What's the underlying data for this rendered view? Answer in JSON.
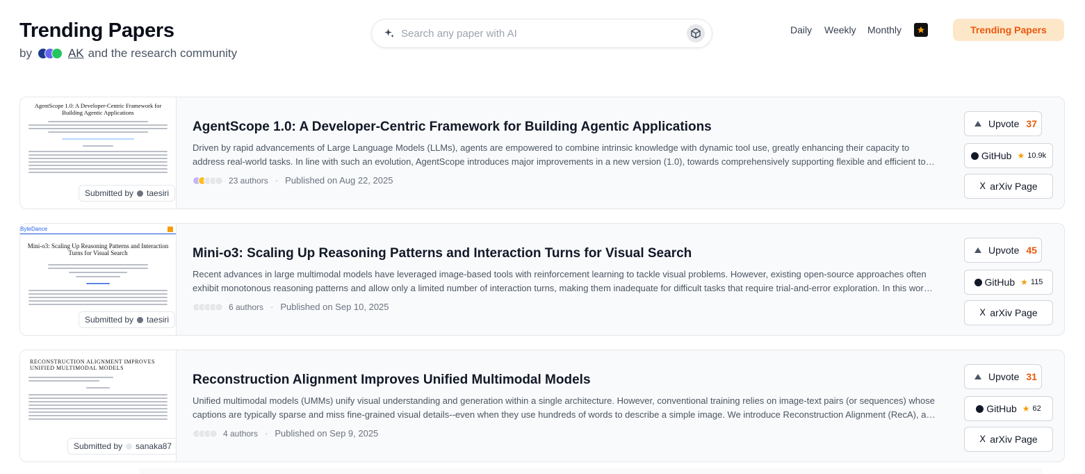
{
  "header": {
    "title": "Trending Papers",
    "by": "by",
    "ak": "AK",
    "community": "and the research community"
  },
  "search": {
    "placeholder": "Search any paper with AI"
  },
  "nav": {
    "daily": "Daily",
    "weekly": "Weekly",
    "monthly": "Monthly",
    "trending": "Trending Papers"
  },
  "papers": [
    {
      "thumb_title": "AgentScope 1.0: A Developer-Centric Framework for Building Agentic Applications",
      "title": "AgentScope 1.0: A Developer-Centric Framework for Building Agentic Applications",
      "abstract": "Driven by rapid advancements of Large Language Models (LLMs), agents are empowered to combine intrinsic knowledge with dynamic tool use, greatly enhancing their capacity to address real-world tasks. In line with such an evolution, AgentScope introduces major improvements in a new version (1.0), towards comprehensively supporting flexible and efficient tool-based agent-environment interactions for building agentic applications.",
      "authors": "23 authors",
      "published": "Published on Aug 22, 2025",
      "submitted_label": "Submitted by",
      "submitter": "taesiri",
      "upvote_label": "Upvote",
      "upvotes": "37",
      "github_label": "GitHub",
      "github_stars": "10.9k",
      "arxiv_label": "arXiv Page"
    },
    {
      "thumb_title": "Mini-o3: Scaling Up Reasoning Patterns and Interaction Turns for Visual Search",
      "thumb_brand": "ByteDance",
      "title": "Mini-o3: Scaling Up Reasoning Patterns and Interaction Turns for Visual Search",
      "abstract": "Recent advances in large multimodal models have leveraged image-based tools with reinforcement learning to tackle visual problems. However, existing open-source approaches often exhibit monotonous reasoning patterns and allow only a limited number of interaction turns, making them inadequate for difficult tasks that require trial-and-error exploration. In this work, we address this limitation by scaling up tool-based interactions.",
      "authors": "6 authors",
      "published": "Published on Sep 10, 2025",
      "submitted_label": "Submitted by",
      "submitter": "taesiri",
      "upvote_label": "Upvote",
      "upvotes": "45",
      "github_label": "GitHub",
      "github_stars": "115",
      "arxiv_label": "arXiv Page"
    },
    {
      "thumb_title": "RECONSTRUCTION ALIGNMENT IMPROVES UNIFIED MULTIMODAL MODELS",
      "title": "Reconstruction Alignment Improves Unified Multimodal Models",
      "abstract": "Unified multimodal models (UMMs) unify visual understanding and generation within a single architecture. However, conventional training relies on image-text pairs (or sequences) whose captions are typically sparse and miss fine-grained visual details--even when they use hundreds of words to describe a simple image. We introduce Reconstruction Alignment (RecA), a resource-efficient post-training method.",
      "authors": "4 authors",
      "published": "Published on Sep 9, 2025",
      "submitted_label": "Submitted by",
      "submitter": "sanaka87",
      "upvote_label": "Upvote",
      "upvotes": "31",
      "github_label": "GitHub",
      "github_stars": "62",
      "arxiv_label": "arXiv Page"
    }
  ],
  "colors": {
    "accent": "#ea580c",
    "trending_bg": "#fde7c9",
    "star": "#f59e0b"
  }
}
